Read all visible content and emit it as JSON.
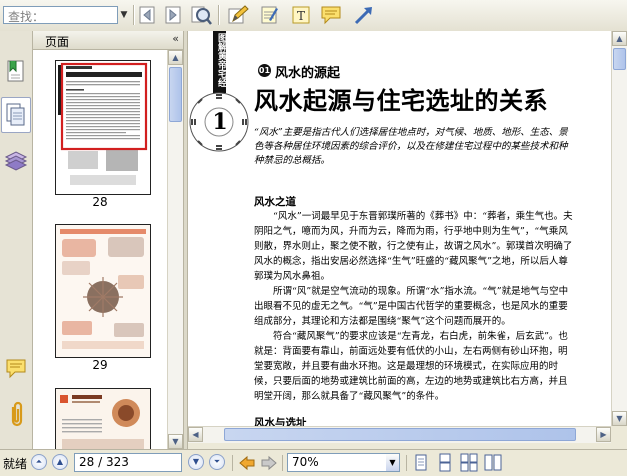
{
  "toolbar": {
    "search_placeholder": "查找：",
    "icons": [
      "back-icon",
      "forward-icon",
      "find-icon",
      "pencil-icon",
      "notepad-icon",
      "text-box-icon",
      "comment-icon",
      "arrow-icon"
    ]
  },
  "left_panel": {
    "title": "页面",
    "collapse_glyph": "«",
    "thumbnails": [
      {
        "label": "28",
        "selected": true
      },
      {
        "label": "29",
        "selected": false
      },
      {
        "label": "",
        "selected": false
      }
    ]
  },
  "document": {
    "side_title": "图解黄帝宅经",
    "chapter_number": "1",
    "section_badge": "01",
    "section_title": "风水的源起",
    "main_title": "风水起源与住宅选址的关系",
    "intro": "“风水”主要是指古代人们选择居住地点时，对气候、地质、地形、生态、景色等各种居住环境因素的综合评价，以及在修建住宅过程中的某些技术和种种禁忌的总概括。",
    "heading1": "风水之道",
    "paragraphs": [
      "“风水”一词最早见于东晋郭璞所著的《葬书》中：“葬者，乘生气也。夫阴阳之气，噫而为风，升而为云，降而为雨，行乎地中则为生气”，“气乘风则散，界水则止，聚之使不散，行之使有止，故谓之风水”。郭璞首次明确了风水的概念，指出安居必然选择“生气”旺盛的“藏风聚气”之地，所以后人尊郭璞为风水鼻祖。",
      "所谓“风”就是空气流动的现象。所谓“水”指水流。“气”就是地气与空中出眼看不见的虚无之气。“气”是中国古代哲学的重要概念，也是风水的重要组成部分，其理论和方法都是围绕“聚气”这个问题而展开的。",
      "符合“藏风聚气”的要求应该是“左青龙，右白虎，前朱雀，后玄武”。也就是：背面要有靠山，前面远处要有低伏的小山，左右两侧有砂山环抱，明堂要宽敞，并且要有曲水环抱。这是最理想的环境模式，在实际应用的时候，只要后面的地势或建筑比前面的高，左边的地势或建筑比右方高，并且明堂开阔，那么就具备了“藏风聚气”的条件。"
    ],
    "heading2": "风水与选址"
  },
  "statusbar": {
    "status": "就绪",
    "page_value": "28 / 323",
    "zoom_value": "70%"
  },
  "colors": {
    "accent": "#3d6bb5",
    "thumb_selection": "#d21f1f"
  }
}
